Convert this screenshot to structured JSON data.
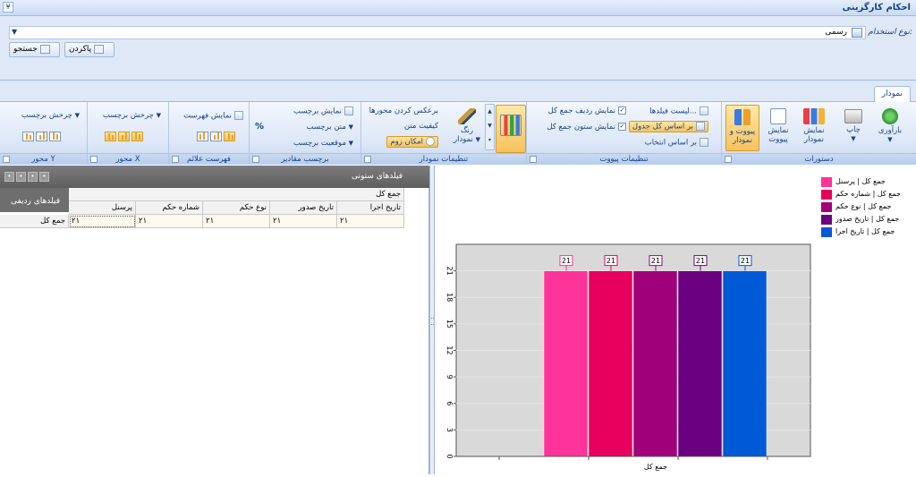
{
  "window": {
    "title": "احکام کارگزینی"
  },
  "search": {
    "employment_type_label": "نوع استخدام:",
    "employment_type_value": "رسمی",
    "clear_label": "پاکردن",
    "search_label": "جستجو"
  },
  "ribbon": {
    "tab": "نمودار",
    "groups": {
      "commands": {
        "caption": "دستورات",
        "refresh": "بارآوری",
        "print": "چاپ",
        "show_chart": "نمایش نمودار",
        "show_pivot": "نمایش پیووت",
        "pivot_and_chart": "پیووت و نمودار"
      },
      "pivot_settings": {
        "caption": "تنظیمات پیووت",
        "field_list": "لیست فیلدها...",
        "by_whole_table": "بر اساس کل جدول",
        "by_selection": "بر اساس انتخاب",
        "show_total_row": "نمایش ردیف جمع کل",
        "show_total_column": "نمایش ستون جمع کل"
      },
      "chart_settings": {
        "caption": "تنظیمات نمودار",
        "chart_color": "رنگ نمودار",
        "flip_axes": "برعکس کردن محورها",
        "text_quality": "کیفیت متن",
        "zoom": "امکان زوم"
      },
      "value_labels": {
        "caption": "برچسب مقادیر",
        "show_label": "نمایش برچسب",
        "label_text": "متن برچسب",
        "label_position": "موقعیت برچسب",
        "percent": "%"
      },
      "legend": {
        "caption": "فهرست علائم",
        "show_legend": "نمایش فهرست"
      },
      "x_axis": {
        "caption": "محور X",
        "rotate_label": "چرخش برچسب"
      },
      "y_axis": {
        "caption": "محور Y",
        "rotate_label": "چرخش برچسب"
      }
    }
  },
  "pivot": {
    "column_fields": "فیلدهای ستونی",
    "row_fields": "فیلدهای ردیفی",
    "grand_total_header": "جمع کل",
    "columns": [
      "تاریخ اجرا",
      "تاریخ صدور",
      "نوع حکم",
      "شماره حکم",
      "پرسنل"
    ],
    "row_label": "جمع کل",
    "values": [
      "۲۱",
      "۲۱",
      "۲۱",
      "۲۱",
      "۲۱"
    ]
  },
  "chart_data": {
    "type": "bar",
    "categories": [
      "جمع کل"
    ],
    "series": [
      {
        "name": "جمع کل | پرسنل",
        "values": [
          21
        ],
        "color": "#ff3399"
      },
      {
        "name": "جمع کل | شماره حکم",
        "values": [
          21
        ],
        "color": "#e8005e"
      },
      {
        "name": "جمع کل | نوع حکم",
        "values": [
          21
        ],
        "color": "#a0007a"
      },
      {
        "name": "جمع کل | تاریخ صدور",
        "values": [
          21
        ],
        "color": "#6b0080"
      },
      {
        "name": "جمع کل | تاریخ اجرا",
        "values": [
          21
        ],
        "color": "#005ad6"
      }
    ],
    "yticks": [
      0,
      3,
      6,
      9,
      12,
      15,
      18,
      21
    ],
    "ylim": [
      0,
      24
    ],
    "data_labels": [
      "21",
      "21",
      "21",
      "21",
      "21"
    ],
    "grid": true,
    "legend": "top-right"
  }
}
